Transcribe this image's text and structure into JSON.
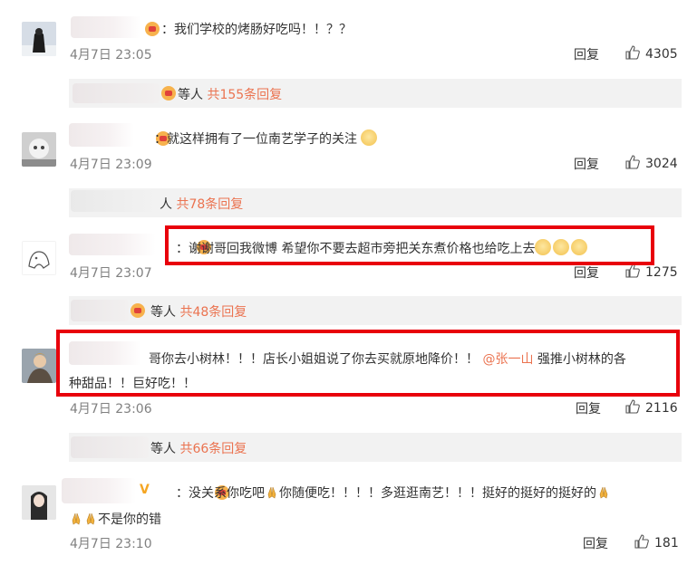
{
  "comments": [
    {
      "text": "：我们学校的烤肠好吃吗！！？？",
      "time": "4月7日 23:05",
      "reply": "回复",
      "likes": "4305"
    },
    {
      "text": "：就这样拥有了一位南艺学子的关注",
      "time": "4月7日 23:09",
      "reply": "回复",
      "likes": "3024"
    },
    {
      "text": "：谢谢哥回我微博 希望你不要去超市旁把关东煮价格也给吃上去",
      "time": "4月7日 23:07",
      "reply": "回复",
      "likes": "1275"
    },
    {
      "text_a": "哥你去小树林！！！店长小姐姐说了你去买就原地降价！！",
      "mention": "@张一山",
      "text_b": "强推小树林的各",
      "text_c": "种甜品！！巨好吃！！",
      "time": "4月7日 23:06",
      "reply": "回复",
      "likes": "2116"
    },
    {
      "badge": "V",
      "text_a": "：没关系你吃吧",
      "text_b": "你随便吃！！！！多逛逛南艺！！！挺好的挺好的挺好的",
      "text_c": "不是你的错",
      "time": "4月7日 23:10",
      "reply": "回复",
      "likes": "181"
    }
  ],
  "subreplies": [
    {
      "prefix": "等人",
      "count": "共155条回复"
    },
    {
      "prefix": "人",
      "count": "共78条回复"
    },
    {
      "prefix": "等人",
      "count": "共48条回复"
    },
    {
      "prefix": "等人",
      "count": "共66条回复"
    }
  ],
  "colors": {
    "accent": "#eb7350",
    "highlight_box": "#e8000b",
    "subreply_bg": "#f2f2f2"
  }
}
